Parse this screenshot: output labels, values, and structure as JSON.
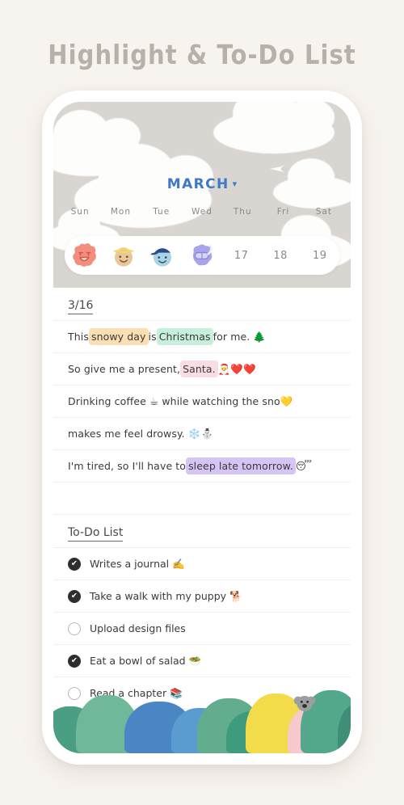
{
  "header": {
    "title": "Highlight & To-Do List"
  },
  "calendar": {
    "month": "MARCH",
    "caret_icon": "chevron-down-icon",
    "weekdays": [
      "Sun",
      "Mon",
      "Tue",
      "Wed",
      "Thu",
      "Fri",
      "Sat"
    ],
    "stickers": [
      {
        "name": "sticker-pink-wink-face",
        "color": "#f28e7e"
      },
      {
        "name": "sticker-straw-hat-face",
        "color": "#e8c79b"
      },
      {
        "name": "sticker-blue-cap-face",
        "color": "#a9d4e6"
      },
      {
        "name": "sticker-snorkel-face",
        "color": "#a9a3e8"
      }
    ],
    "dates": [
      "17",
      "18",
      "19"
    ]
  },
  "journal": {
    "date_label": "3/16",
    "lines": [
      {
        "parts": [
          {
            "t": "This ",
            "hl": null
          },
          {
            "t": "snowy day",
            "hl": "#fbdfb4"
          },
          {
            "t": " is ",
            "hl": null
          },
          {
            "t": "Christmas",
            "hl": "#c6f0db"
          },
          {
            "t": " for me. 🌲",
            "hl": null
          }
        ]
      },
      {
        "parts": [
          {
            "t": "So give me a present, ",
            "hl": null
          },
          {
            "t": "Santa.",
            "hl": "#fadce5"
          },
          {
            "t": " 🎅❤️❤️",
            "hl": null
          }
        ]
      },
      {
        "parts": [
          {
            "t": "Drinking coffee ☕ while watching the sno💛",
            "hl": null
          }
        ]
      },
      {
        "parts": [
          {
            "t": "makes me feel drowsy. ❄️⛄",
            "hl": null
          }
        ]
      },
      {
        "parts": [
          {
            "t": "I'm tired, so I'll have to ",
            "hl": null
          },
          {
            "t": "sleep late tomorrow.",
            "hl": "#d5c5f5"
          },
          {
            "t": " 😴",
            "hl": null
          }
        ]
      },
      {
        "parts": []
      }
    ]
  },
  "todo": {
    "title": "To-Do List",
    "items": [
      {
        "label": "Writes a journal ✍️",
        "done": true
      },
      {
        "label": "Take a walk with my puppy 🐕",
        "done": true
      },
      {
        "label": "Upload design files",
        "done": false
      },
      {
        "label": "Eat a bowl of salad 🥗",
        "done": true
      },
      {
        "label": "Read a chapter 📚",
        "done": false
      }
    ],
    "check_icon": "check-icon"
  },
  "footer": {
    "illustration": "forest-with-koala",
    "tree_colors": [
      "#4fa485",
      "#6fb89a",
      "#4a86c4",
      "#5a9cd0",
      "#62ad8d",
      "#3f9b7e",
      "#f2dc4a",
      "#f7c8cc",
      "#53a88b",
      "#3f8f78"
    ],
    "koala_color": "#9aa0a0"
  },
  "theme": {
    "background": "#f7f3ee",
    "sky": "#d9d6d1",
    "accent_blue": "#3f78c6",
    "title_gray": "#b8b1a9"
  }
}
